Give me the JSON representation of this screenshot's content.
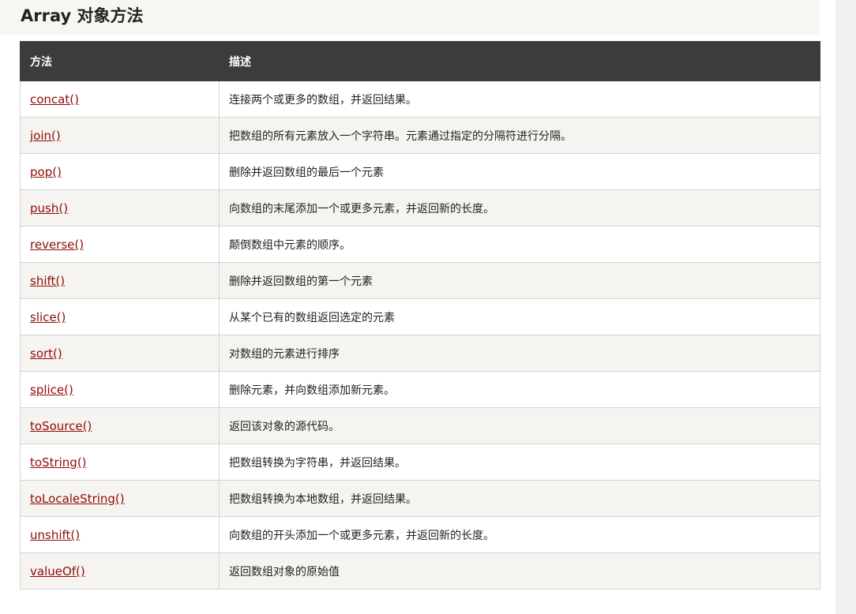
{
  "title": "Array 对象方法",
  "table": {
    "headers": [
      "方法",
      "描述"
    ],
    "rows": [
      {
        "method": "concat()",
        "description": "连接两个或更多的数组，并返回结果。"
      },
      {
        "method": "join()",
        "description": "把数组的所有元素放入一个字符串。元素通过指定的分隔符进行分隔。"
      },
      {
        "method": "pop()",
        "description": "删除并返回数组的最后一个元素"
      },
      {
        "method": "push()",
        "description": "向数组的末尾添加一个或更多元素，并返回新的长度。"
      },
      {
        "method": "reverse()",
        "description": "颠倒数组中元素的顺序。"
      },
      {
        "method": "shift()",
        "description": "删除并返回数组的第一个元素"
      },
      {
        "method": "slice()",
        "description": "从某个已有的数组返回选定的元素"
      },
      {
        "method": "sort()",
        "description": "对数组的元素进行排序"
      },
      {
        "method": "splice()",
        "description": "删除元素，并向数组添加新元素。"
      },
      {
        "method": "toSource()",
        "description": "返回该对象的源代码。"
      },
      {
        "method": "toString()",
        "description": "把数组转换为字符串，并返回结果。"
      },
      {
        "method": "toLocaleString()",
        "description": "把数组转换为本地数组，并返回结果。"
      },
      {
        "method": "unshift()",
        "description": "向数组的开头添加一个或更多元素，并返回新的长度。"
      },
      {
        "method": "valueOf()",
        "description": "返回数组对象的原始值"
      }
    ]
  },
  "colors": {
    "header_bg": "#3c3c3c",
    "link": "#900b09",
    "row_alt": "#f6f4f0",
    "title_bg": "#f7f7f2"
  }
}
